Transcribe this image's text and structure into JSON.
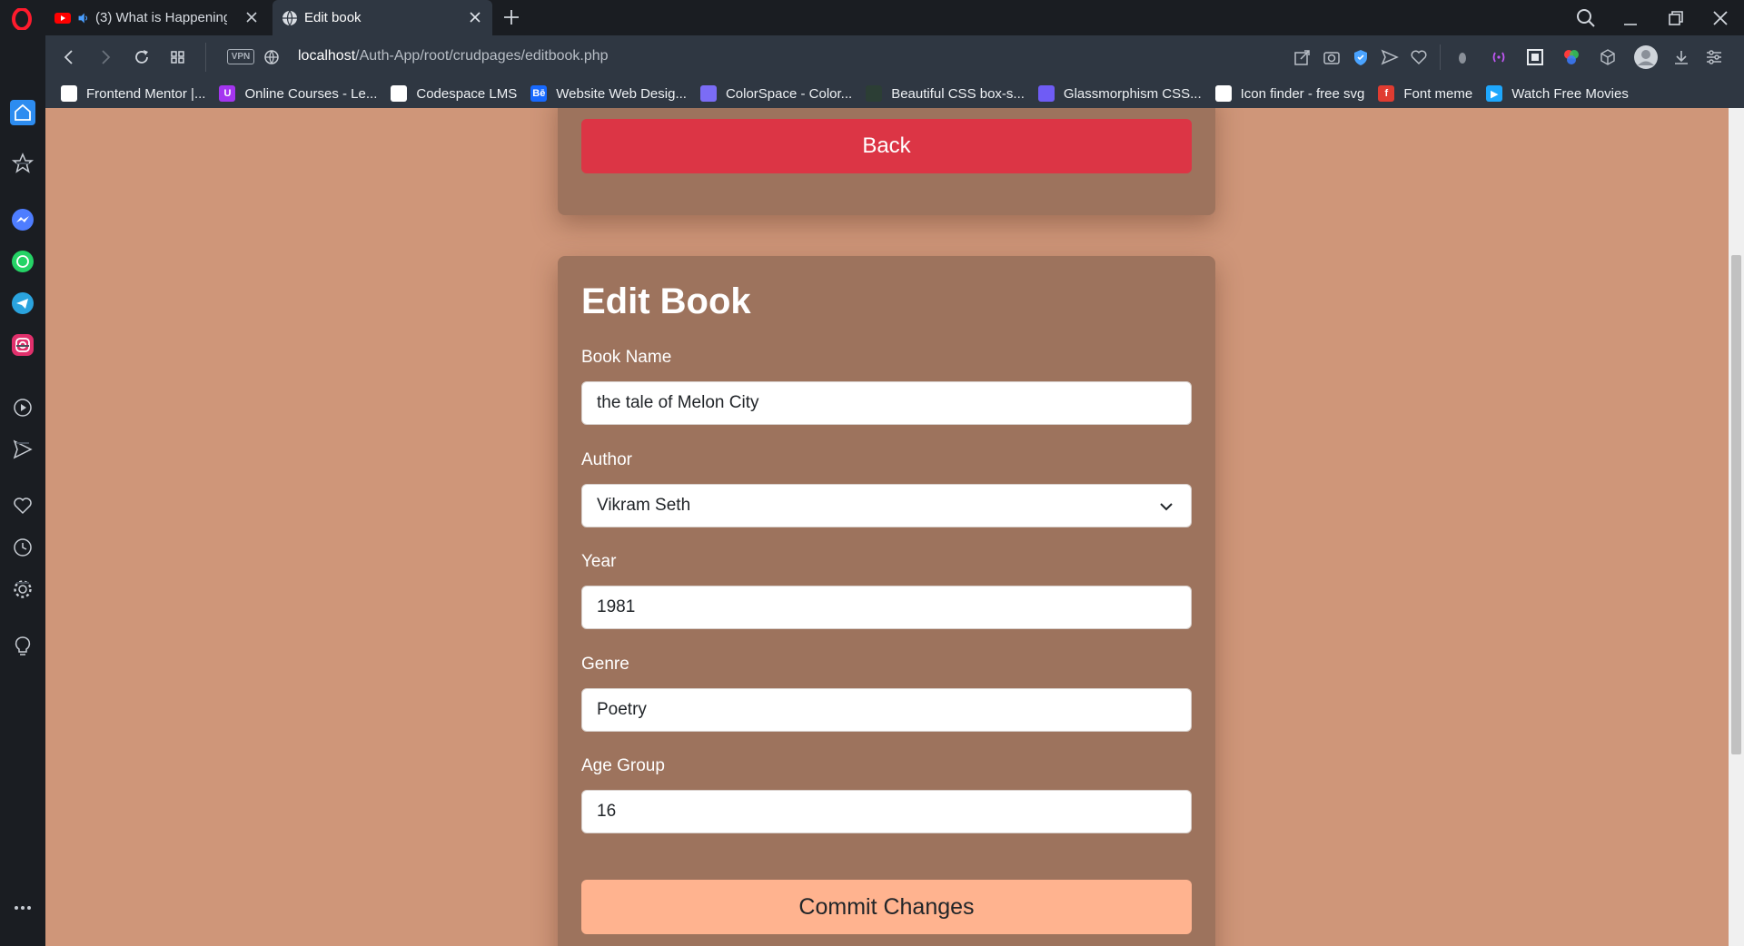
{
  "browser": {
    "tabs": [
      {
        "label": "(3) What is Happening …"
      },
      {
        "label": "Edit book"
      }
    ],
    "vpn_label": "VPN",
    "url_host": "localhost",
    "url_path": "/Auth-App/root/crudpages/editbook.php"
  },
  "bookmarks": [
    {
      "label": "Frontend Mentor |...",
      "icon": "frontend-mentor-icon",
      "color": "#ffffff",
      "glyph": ""
    },
    {
      "label": "Online Courses - Le...",
      "icon": "udemy-icon",
      "color": "#a435f0",
      "glyph": "U"
    },
    {
      "label": "Codespace LMS",
      "icon": "document-icon",
      "color": "#ffffff",
      "glyph": ""
    },
    {
      "label": "Website Web Desig...",
      "icon": "behance-icon",
      "color": "#1769ff",
      "glyph": "Bē"
    },
    {
      "label": "ColorSpace - Color...",
      "icon": "colorspace-icon",
      "color": "#7b6cf6",
      "glyph": ""
    },
    {
      "label": "Beautiful CSS box-s...",
      "icon": "cursor-icon",
      "color": "#2c3e35",
      "glyph": ""
    },
    {
      "label": "Glassmorphism CSS...",
      "icon": "glassmorphism-icon",
      "color": "#6f5cf5",
      "glyph": ""
    },
    {
      "label": "Icon finder - free svg",
      "icon": "iconfinder-icon",
      "color": "#ffffff",
      "glyph": ""
    },
    {
      "label": "Font meme",
      "icon": "fontmeme-icon",
      "color": "#e03c31",
      "glyph": "f"
    },
    {
      "label": "Watch Free Movies",
      "icon": "play-icon",
      "color": "#1ea7fd",
      "glyph": "▶"
    }
  ],
  "page": {
    "back_label": "Back",
    "title": "Edit Book",
    "fields": {
      "book_name": {
        "label": "Book Name",
        "value": "the tale of Melon City"
      },
      "author": {
        "label": "Author",
        "value": "Vikram Seth"
      },
      "year": {
        "label": "Year",
        "value": "1981"
      },
      "genre": {
        "label": "Genre",
        "value": "Poetry"
      },
      "age_group": {
        "label": "Age Group",
        "value": "16"
      }
    },
    "commit_label": "Commit Changes"
  },
  "colors": {
    "page_bg": "#cf9679",
    "card_bg": "#9d735d",
    "back_button": "#dc3545",
    "commit_button": "#ffb38f"
  }
}
